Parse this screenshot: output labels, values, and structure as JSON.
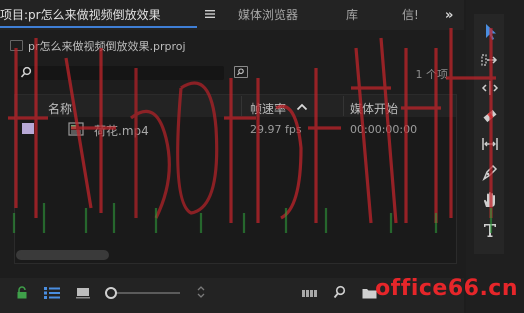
{
  "tabs": [
    {
      "label": "项目:pr怎么来做视频倒放效果"
    },
    {
      "label": "媒体浏览器"
    },
    {
      "label": "库"
    },
    {
      "label": "信!"
    }
  ],
  "tab_more": "»",
  "project_path": "pr怎么来做视频倒放效果.prproj",
  "search": {
    "placeholder": ""
  },
  "items_count": "1 个项",
  "columns": {
    "name": "名称",
    "frame_rate": "帧速率",
    "media_start": "媒体开始"
  },
  "rows": [
    {
      "name": "荷花.mp4",
      "frame_rate": "29.97 fps",
      "media_start": "00:00:00:00",
      "label_color": "#b8a9d6"
    }
  ],
  "watermark": {
    "text_large": "书吧网 office教程",
    "logo": "office66.cn"
  },
  "colors": {
    "accent": "#3f7fd6",
    "lock_icon": "#3fa04a",
    "watermark": "#e6262a",
    "watermark_green": "#2f9a3a"
  },
  "toolbar_icons": [
    "selection-tool-icon",
    "track-select-tool-icon",
    "ripple-edit-tool-icon",
    "razor-tool-icon",
    "slip-tool-icon",
    "pen-tool-icon",
    "hand-tool-icon",
    "type-tool-icon"
  ]
}
